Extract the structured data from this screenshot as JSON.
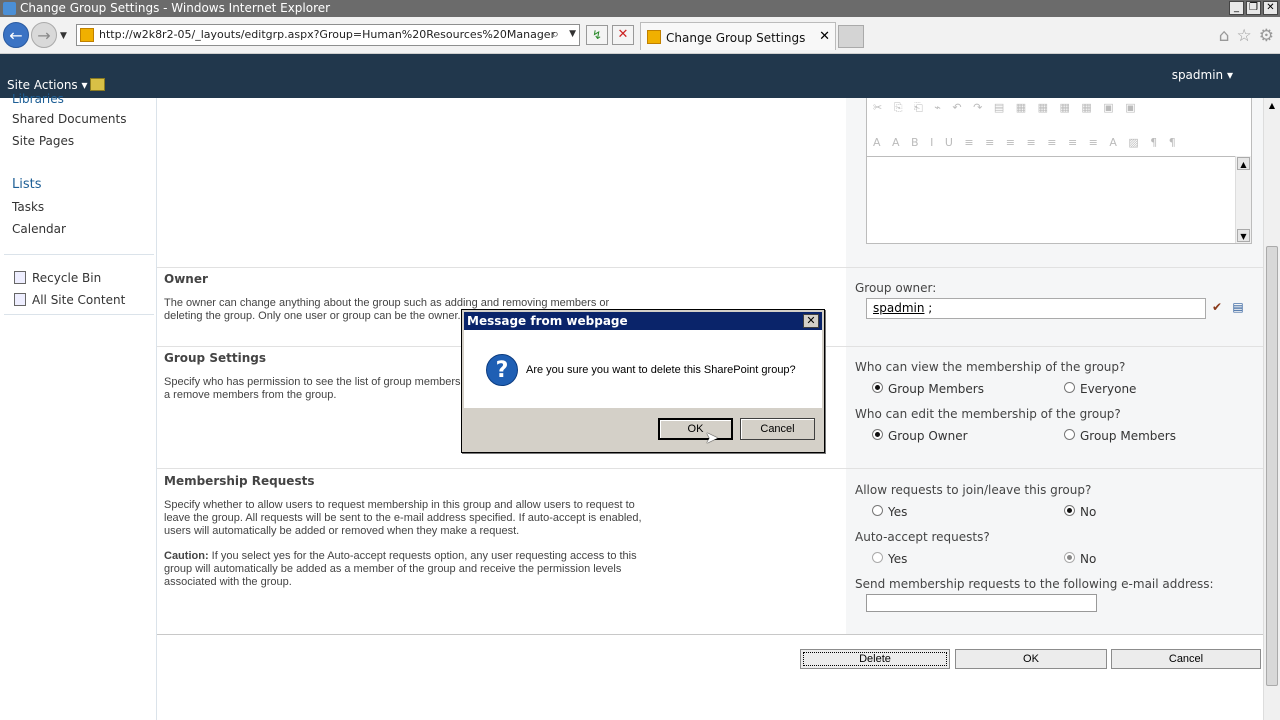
{
  "window": {
    "title": "Change Group Settings - Windows Internet Explorer",
    "controls": [
      "_",
      "❐",
      "✕"
    ]
  },
  "browser": {
    "url": "http://w2k8r2-05/_layouts/editgrp.aspx?Group=Human%20Resources%20Manager",
    "tab_label": "Change Group Settings",
    "tab_close": "✕",
    "back": "←",
    "forward": "→",
    "refresh": "↯",
    "stop": "✕",
    "right_icons": [
      "⌂",
      "☆",
      "⚙"
    ]
  },
  "ribbon": {
    "site_actions": "Site Actions ▾",
    "user": "spadmin ▾"
  },
  "leftnav": {
    "clipped_heading": "Libraries",
    "libraries": [
      "Shared Documents",
      "Site Pages"
    ],
    "lists_heading": "Lists",
    "lists": [
      "Tasks",
      "Calendar"
    ],
    "recycle_bin": "Recycle Bin",
    "all_site_content": "All Site Content"
  },
  "editor": {
    "toolbar_row1": "✂ ⎘ ⎗ ⌁ ↶ ↷ ▤ ▦ ▦ ▦ ▦ ▣ ▣",
    "toolbar_row2": "A A B I U ≡ ≡ ≡ ≡ ≡ ≡ ≡ A ▨ ¶ ¶"
  },
  "owner": {
    "title": "Owner",
    "desc": "The owner can change anything about the group such as adding and removing members or deleting the group. Only one user or group can be the owner.",
    "label": "Group owner:",
    "value": "spadmin",
    "suffix": " ;"
  },
  "group_settings": {
    "title": "Group Settings",
    "desc": "Specify who has permission to see the list of group members a remove members from the group.",
    "view_question": "Who can view the membership of the group?",
    "view_opt1": "Group Members",
    "view_opt2": "Everyone",
    "edit_question": "Who can edit the membership of the group?",
    "edit_opt1": "Group Owner",
    "edit_opt2": "Group Members"
  },
  "membership": {
    "title": "Membership Requests",
    "desc": "Specify whether to allow users to request membership in this group and allow users to request to leave the group. All requests will be sent to the e-mail address specified. If auto-accept is enabled, users will automatically be added or removed when they make a request.",
    "caution_label": "Caution:",
    "caution_text": " If you select yes for the Auto-accept requests option, any user requesting access to this group will automatically be added as a member of the group and receive the permission levels associated with the group.",
    "allow_question": "Allow requests to join/leave this group?",
    "allow_yes": "Yes",
    "allow_no": "No",
    "auto_question": "Auto-accept requests?",
    "auto_yes": "Yes",
    "auto_no": "No",
    "email_label": "Send membership requests to the following e-mail address:",
    "email_value": ""
  },
  "buttons": {
    "delete": "Delete",
    "ok": "OK",
    "cancel": "Cancel"
  },
  "dialog": {
    "title": "Message from webpage",
    "close": "✕",
    "icon": "?",
    "message": "Are you sure you want to delete this SharePoint group?",
    "ok": "OK",
    "cancel": "Cancel"
  }
}
